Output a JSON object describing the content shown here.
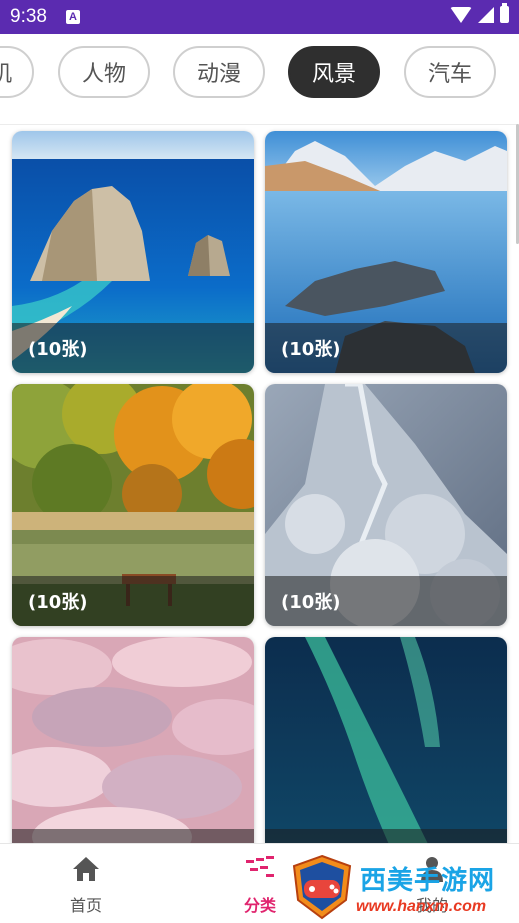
{
  "status_bar": {
    "time": "9:38",
    "notification_icon": "a-icon",
    "icons": [
      "wifi-icon",
      "signal-icon",
      "battery-icon"
    ]
  },
  "categories": {
    "items": [
      {
        "label": "机"
      },
      {
        "label": "人物"
      },
      {
        "label": "动漫"
      },
      {
        "label": "风景",
        "active": true
      },
      {
        "label": "汽车"
      }
    ]
  },
  "gallery": {
    "cards": [
      {
        "count": "(10张)",
        "scene": "sea-rocks"
      },
      {
        "count": "(10张)",
        "scene": "mountain-lake"
      },
      {
        "count": "(10张)",
        "scene": "autumn-forest"
      },
      {
        "count": "(10张)",
        "scene": "snowy-great-wall"
      },
      {
        "count": "",
        "scene": "pink-clouds"
      },
      {
        "count": "",
        "scene": "aurora"
      }
    ]
  },
  "bottom_nav": {
    "items": [
      {
        "label": "首页",
        "icon": "home-icon"
      },
      {
        "label": "分类",
        "icon": "category-icon",
        "active": true
      },
      {
        "label": "我的",
        "icon": "profile-icon"
      }
    ]
  },
  "watermark": {
    "text": "西美手游网",
    "url": "www.hanxm.com"
  },
  "colors": {
    "status_bar": "#5b2bb0",
    "active_chip": "#2f2f2f",
    "active_nav": "#e0246e"
  }
}
